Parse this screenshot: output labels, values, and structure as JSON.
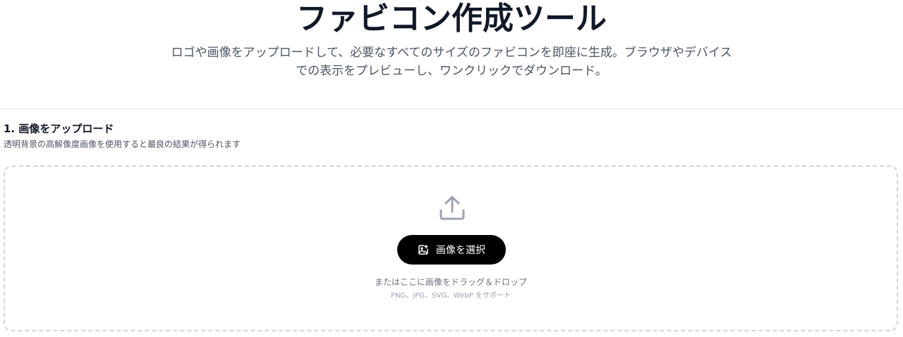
{
  "hero": {
    "title": "ファビコン作成ツール",
    "description": "ロゴや画像をアップロードして、必要なすべてのサイズのファビコンを即座に生成。ブラウザやデバイスでの表示をプレビューし、ワンクリックでダウンロード。"
  },
  "upload_section": {
    "title": "1. 画像をアップロード",
    "subtitle": "透明背景の高解像度画像を使用すると最良の結果が得られます",
    "dropzone": {
      "upload_icon": "upload-icon",
      "button_label": "画像を選択",
      "button_icon": "image-plus-icon",
      "drop_hint": "またはここに画像をドラッグ＆ドロップ",
      "supported_formats": "PNG、JPG、SVG、WebP をサポート"
    }
  },
  "colors": {
    "button_bg": "#000000",
    "button_text": "#ffffff",
    "border": "#d1d5db",
    "muted_text": "#6b7280"
  }
}
